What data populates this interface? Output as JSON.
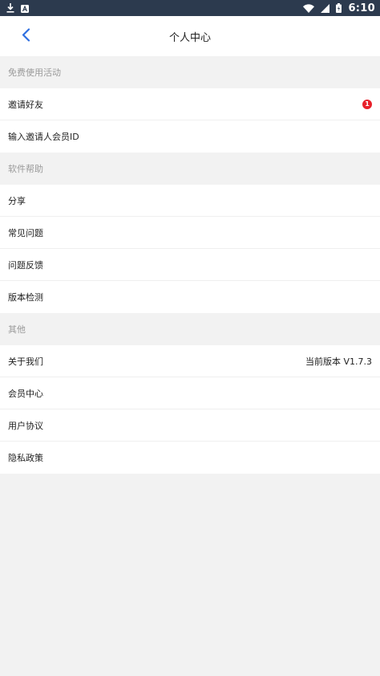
{
  "status_bar": {
    "time": "6:10",
    "icons": [
      "download-icon",
      "notification-a-icon",
      "wifi-icon",
      "signal-icon",
      "battery-icon"
    ]
  },
  "header": {
    "title": "个人中心",
    "back_icon": "chevron-left-icon"
  },
  "sections": [
    {
      "title": "免费使用活动",
      "items": [
        {
          "label": "邀请好友",
          "badge": "1"
        },
        {
          "label": "输入邀请人会员ID"
        }
      ]
    },
    {
      "title": "软件帮助",
      "items": [
        {
          "label": "分享"
        },
        {
          "label": "常见问题"
        },
        {
          "label": "问题反馈"
        },
        {
          "label": "版本检测"
        }
      ]
    },
    {
      "title": "其他",
      "items": [
        {
          "label": "关于我们",
          "value": "当前版本 V1.7.3"
        },
        {
          "label": "会员中心"
        },
        {
          "label": "用户协议"
        },
        {
          "label": "隐私政策"
        }
      ]
    }
  ],
  "colors": {
    "accent": "#2f6fe0",
    "badge": "#e8202a",
    "status_bar": "#2c3a4e",
    "section_bg": "#f2f2f2"
  }
}
